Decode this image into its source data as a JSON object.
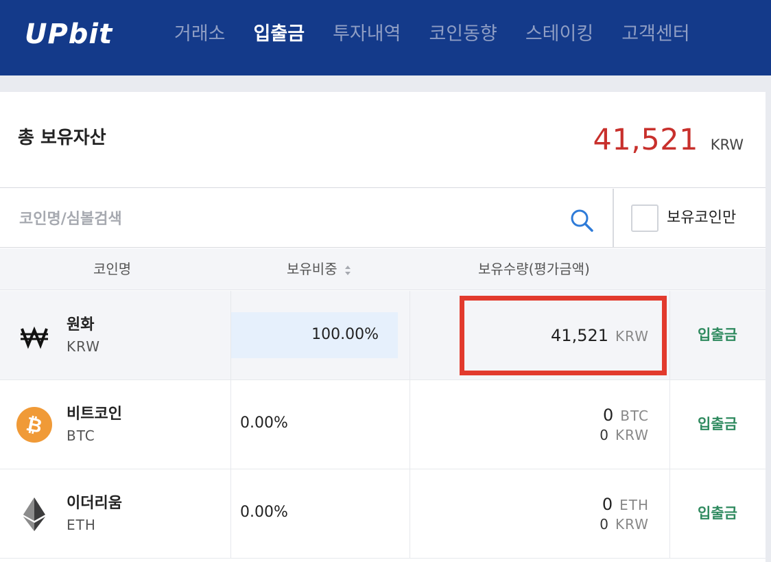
{
  "header": {
    "logo": "UPbit",
    "nav": [
      {
        "label": "거래소",
        "active": false
      },
      {
        "label": "입출금",
        "active": true
      },
      {
        "label": "투자내역",
        "active": false
      },
      {
        "label": "코인동향",
        "active": false
      },
      {
        "label": "스테이킹",
        "active": false
      },
      {
        "label": "고객센터",
        "active": false
      }
    ]
  },
  "summary": {
    "title": "총 보유자산",
    "amount": "41,521",
    "unit": "KRW"
  },
  "search": {
    "placeholder": "코인명/심볼검색",
    "value": "",
    "held_only_label": "보유코인만",
    "held_only_checked": false
  },
  "table": {
    "headers": {
      "name": "코인명",
      "weight": "보유비중",
      "quantity": "보유수량(평가금액)"
    },
    "rows": [
      {
        "name": "원화",
        "symbol": "KRW",
        "icon": "won-icon",
        "weight": "100.00%",
        "weight_fraction": 1.0,
        "quantity": "41,521",
        "quantity_unit": "KRW",
        "action": "입출금"
      },
      {
        "name": "비트코인",
        "symbol": "BTC",
        "icon": "bitcoin-icon",
        "weight": "0.00%",
        "weight_fraction": 0,
        "quantity": "0",
        "quantity_unit": "BTC",
        "value": "0",
        "value_unit": "KRW",
        "action": "입출금"
      },
      {
        "name": "이더리움",
        "symbol": "ETH",
        "icon": "ethereum-icon",
        "weight": "0.00%",
        "weight_fraction": 0,
        "quantity": "0",
        "quantity_unit": "ETH",
        "value": "0",
        "value_unit": "KRW",
        "action": "입출금"
      }
    ]
  },
  "colors": {
    "header_bg": "#143a8a",
    "amount_red": "#c8302c",
    "deposit_green": "#2f8a5f",
    "highlight_border": "#e23a2d",
    "weight_bar": "#e6f0fc"
  }
}
